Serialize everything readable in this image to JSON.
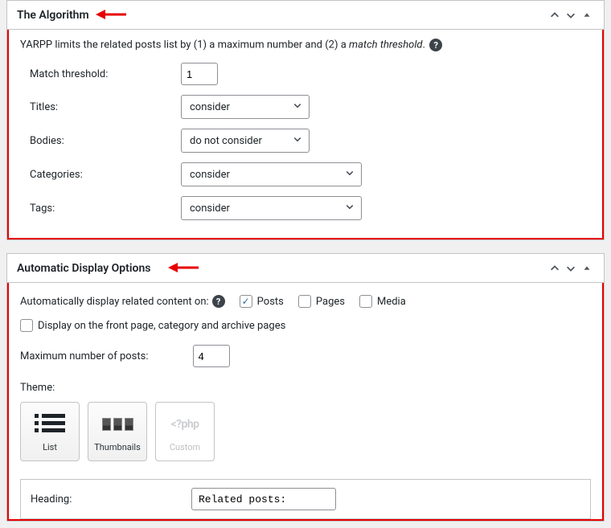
{
  "section1": {
    "title": "The Algorithm",
    "desc_prefix": "YARPP limits the related posts list by (1) a maximum number and (2) a ",
    "desc_em": "match threshold",
    "desc_suffix": ".",
    "rows": {
      "match_threshold": {
        "label": "Match threshold:",
        "value": "1"
      },
      "titles": {
        "label": "Titles:",
        "value": "consider"
      },
      "bodies": {
        "label": "Bodies:",
        "value": "do not consider"
      },
      "categories": {
        "label": "Categories:",
        "value": "consider"
      },
      "tags": {
        "label": "Tags:",
        "value": "consider"
      }
    }
  },
  "section2": {
    "title": "Automatic Display Options",
    "auto_label": "Automatically display related content on:",
    "types": {
      "posts": {
        "label": "Posts",
        "checked": true
      },
      "pages": {
        "label": "Pages",
        "checked": false
      },
      "media": {
        "label": "Media",
        "checked": false
      }
    },
    "front_page": {
      "label": "Display on the front page, category and archive pages",
      "checked": false
    },
    "max_posts": {
      "label": "Maximum number of posts:",
      "value": "4"
    },
    "theme_label": "Theme:",
    "themes": {
      "list": "List",
      "thumbs": "Thumbnails",
      "custom": "Custom"
    },
    "heading": {
      "label": "Heading:",
      "value": "Related posts:"
    }
  }
}
